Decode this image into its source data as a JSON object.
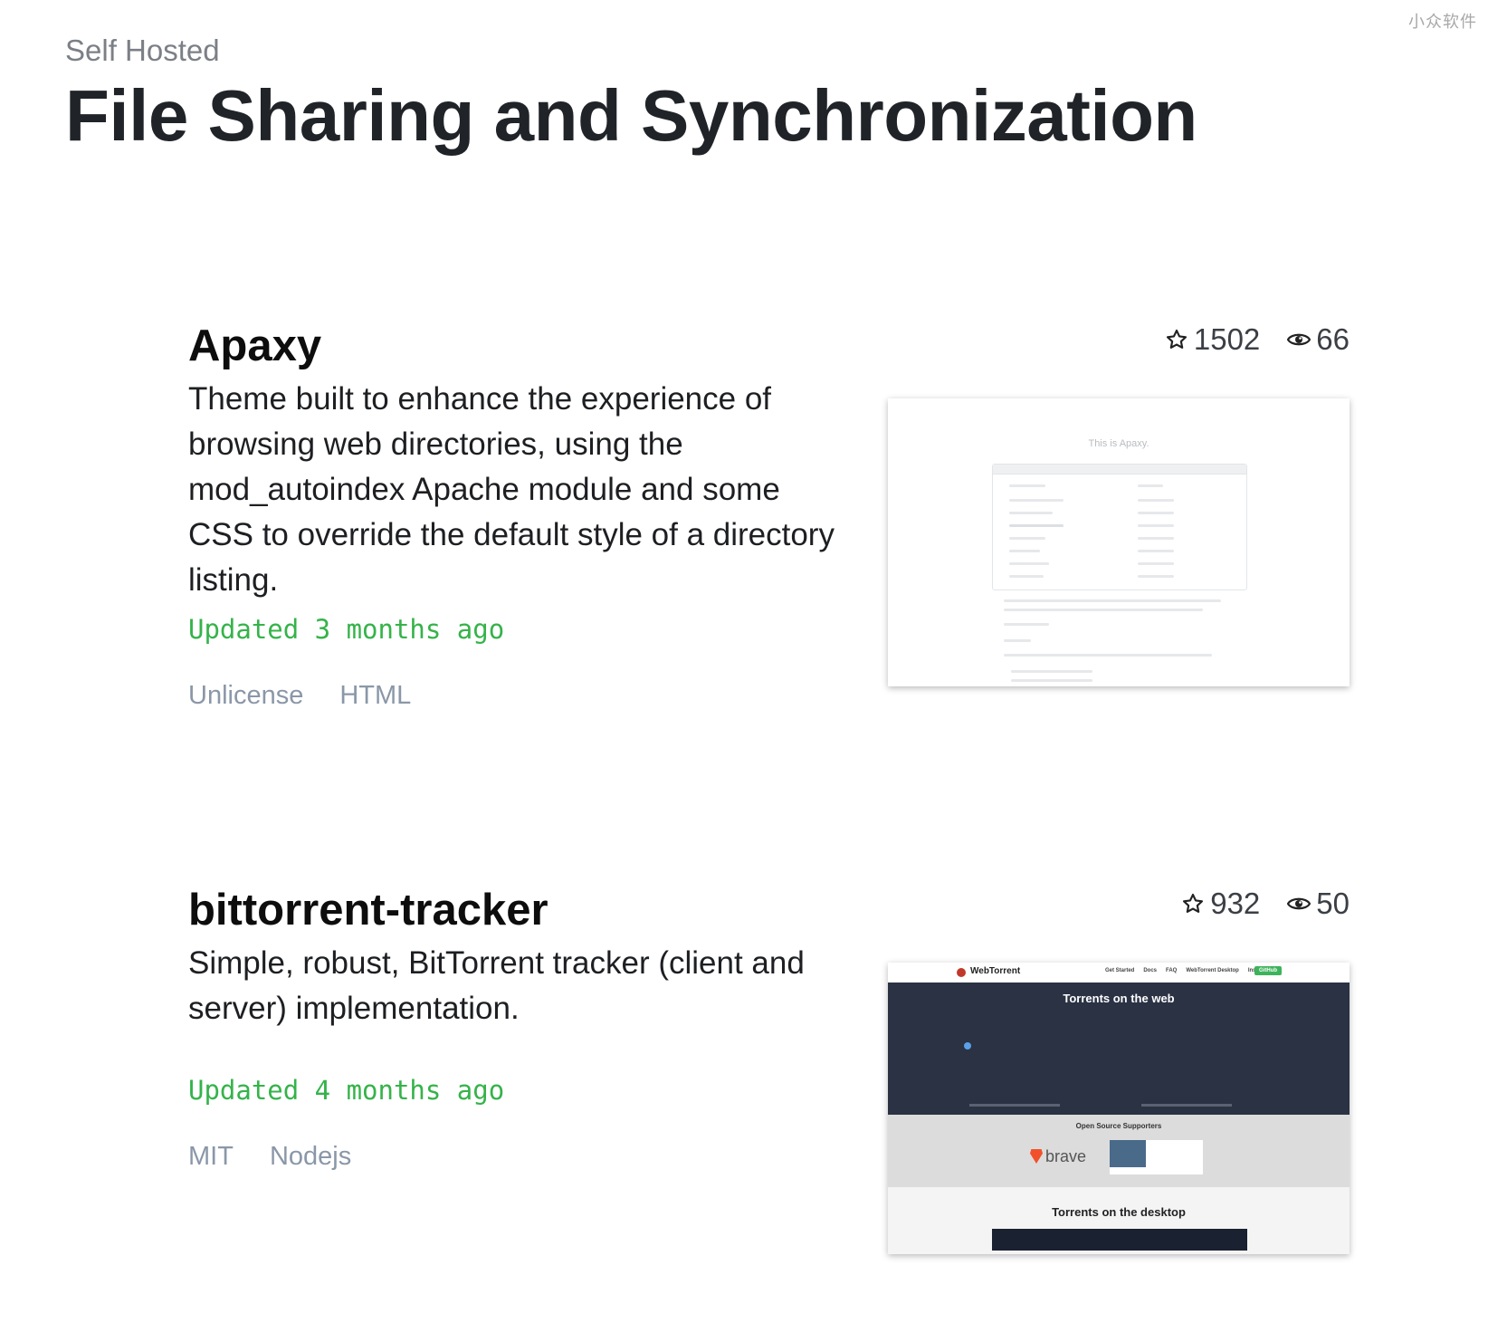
{
  "watermark": "小众软件",
  "header": {
    "eyebrow": "Self Hosted",
    "title": "File Sharing and Synchronization"
  },
  "projects": [
    {
      "name": "Apaxy",
      "stars": "1502",
      "watchers": "66",
      "description": "Theme built to enhance the experience of browsing web directories, using the mod_autoindex Apache module and some CSS to override the default style of a directory listing.",
      "updated": "Updated 3 months ago",
      "tags": [
        "Unlicense",
        "HTML"
      ],
      "preview": {
        "caption": "This is Apaxy."
      }
    },
    {
      "name": "bittorrent-tracker",
      "stars": "932",
      "watchers": "50",
      "description": "Simple, robust, BitTorrent tracker (client and server) implementation.",
      "updated": "Updated 4 months ago",
      "tags": [
        "MIT",
        "Nodejs"
      ],
      "preview": {
        "brand": "WebTorrent",
        "nav": [
          "Get Started",
          "Docs",
          "FAQ",
          "WebTorrent Desktop",
          "Instant.io"
        ],
        "github": "GitHub",
        "hero_title": "Torrents on the web",
        "supporters_title": "Open Source Supporters",
        "supporter": "brave",
        "desktop_title": "Torrents on the desktop"
      }
    }
  ],
  "icons": {
    "star": "star-outline-icon",
    "watchers": "eye-icon"
  },
  "colors": {
    "updated": "#35b34a",
    "tags": "#8a97a8",
    "title": "#202428"
  }
}
